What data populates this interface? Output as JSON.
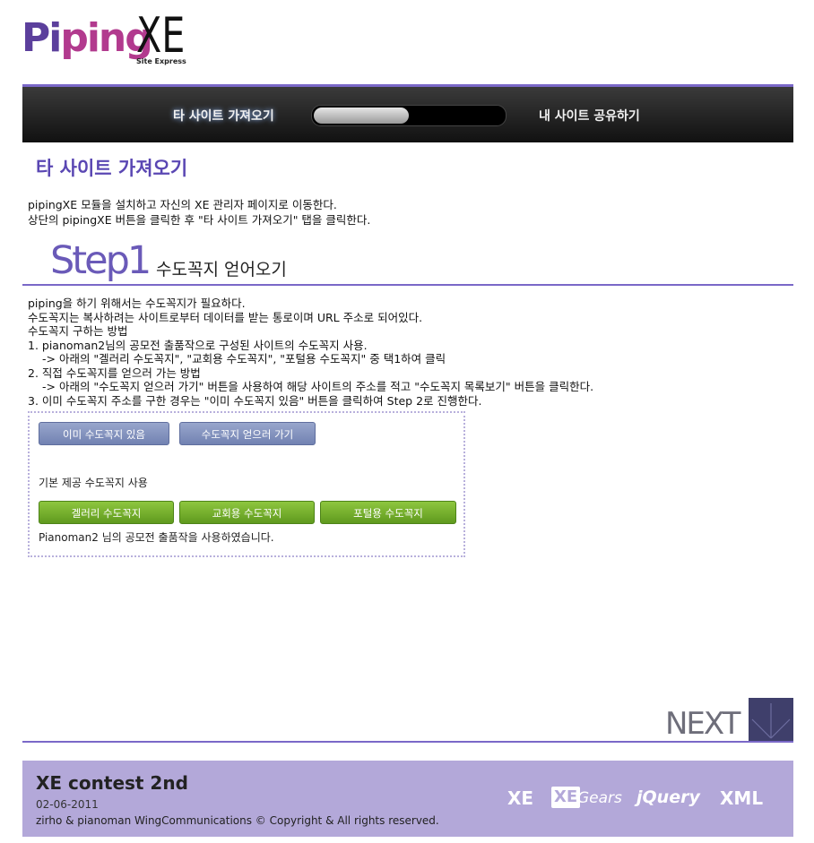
{
  "logo": {
    "piping_a": "Pi",
    "piping_b": "ping",
    "xe": "XE",
    "tagline": "Site Express"
  },
  "nav": {
    "tab_import": "타 사이트 가져오기",
    "tab_share": "내 사이트 공유하기",
    "progress": 0.5
  },
  "page_title": "타 사이트 가져오기",
  "intro": [
    "pipingXE 모듈을 설치하고 자신의 XE 관리자 페이지로 이동한다.",
    "상단의 pipingXE 버튼을 클릭한 후 \"타 사이트 가져오기\" 탭을 클릭한다."
  ],
  "step": {
    "big": "Step1",
    "sub": "수도꼭지 얻어오기"
  },
  "instructions": [
    "piping을 하기 위해서는 수도꼭지가 필요하다.",
    "수도꼭지는 복사하려는 사이트로부터 데이터를 받는 통로이며 URL 주소로 되어있다.",
    "수도꼭지 구하는 방법",
    "1. pianoman2님의 공모전 출품작으로 구성된 사이트의 수도꼭지 사용.",
    "-> 아래의 \"겔러리 수도꼭지\", \"교회용 수도꼭지\", \"포털용 수도꼭지\" 중 택1하여 클릭",
    "2. 직접 수도꼭지를 얻으러 가는 방법",
    "-> 아래의 \"수도꼭지 얻으러 가기\" 버튼을 사용하여 해당 사이트의 주소를 적고 \"수도꼭지 목록보기\" 버튼을 클릭한다.",
    "3. 이미 수도꼭지 주소를 구한 경우는 \"이미 수도꼭지 있음\" 버튼을 클릭하여 Step 2로 진행한다."
  ],
  "panel": {
    "btn_have": "이미 수도꼭지 있음",
    "btn_get": "수도꼭지 얻으러 가기",
    "caption": "기본 제공 수도꼭지 사용",
    "btn_gallery": "겔러리 수도꼭지",
    "btn_church": "교회용 수도꼭지",
    "btn_portal": "포털용 수도꼭지",
    "note": "Pianoman2 님의 공모전 출품작을 사용하였습니다."
  },
  "next_label": "NEXT",
  "footer": {
    "title": "XE contest 2nd",
    "date": "02-06-2011",
    "copyright": "zirho & pianoman WingCommunications © Copyright & All rights reserved.",
    "logos": [
      "XE",
      "XE",
      "Gears",
      "jQuery",
      "XML"
    ]
  },
  "colors": {
    "accent": "#7a68c8",
    "title": "#5a47b3",
    "footer_bg": "#b3a8d9",
    "button_blue": "#7f8fbe",
    "button_green": "#6fae2a"
  }
}
